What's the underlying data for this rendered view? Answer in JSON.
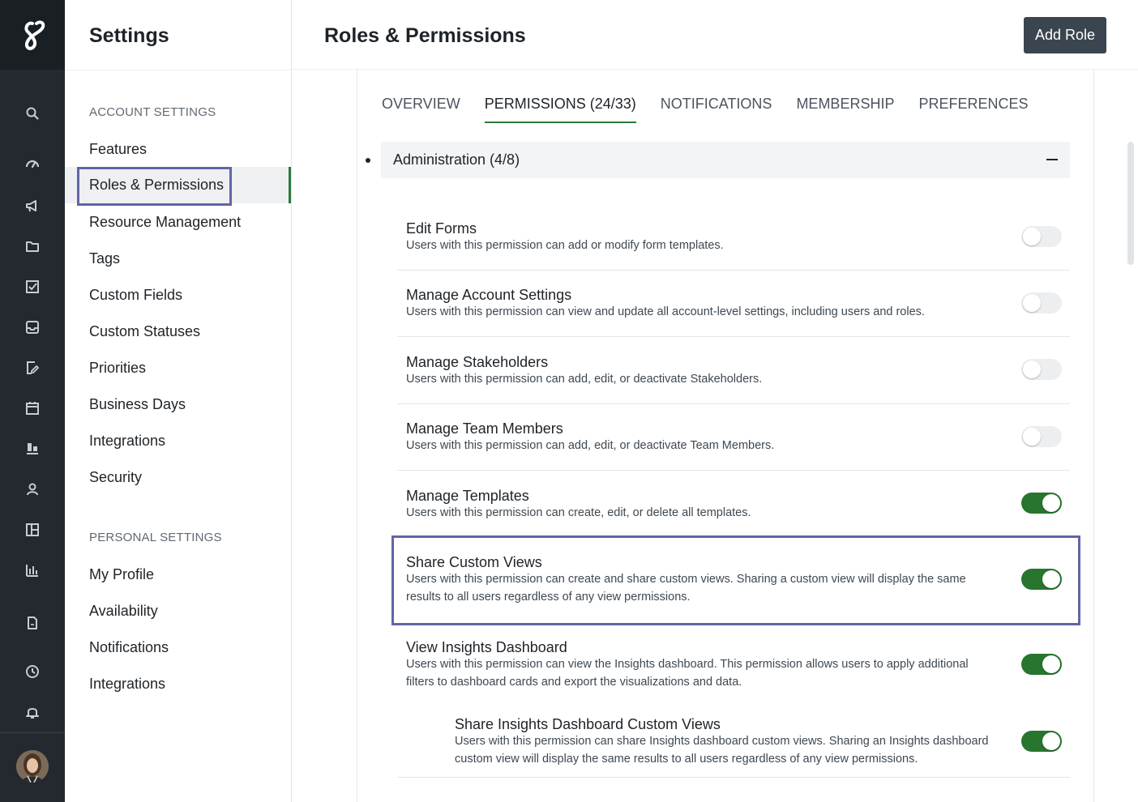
{
  "app": {
    "brand_color": "#2b7a3b",
    "highlight_color": "#6165a8"
  },
  "rail": {
    "icons": [
      "logo-icon",
      "search-icon",
      "dashboard-icon",
      "megaphone-icon",
      "folder-icon",
      "checkbox-icon",
      "inbox-icon",
      "form-edit-icon",
      "calendar-icon",
      "workload-icon",
      "person-icon",
      "layout-icon",
      "chart-icon",
      "document-icon",
      "clock-icon",
      "bell-icon"
    ]
  },
  "sidebar": {
    "title": "Settings",
    "account_label": "ACCOUNT SETTINGS",
    "account_items": [
      {
        "label": "Features"
      },
      {
        "label": "Roles & Permissions"
      },
      {
        "label": "Resource Management"
      },
      {
        "label": "Tags"
      },
      {
        "label": "Custom Fields"
      },
      {
        "label": "Custom Statuses"
      },
      {
        "label": "Priorities"
      },
      {
        "label": "Business Days"
      },
      {
        "label": "Integrations"
      },
      {
        "label": "Security"
      }
    ],
    "personal_label": "PERSONAL SETTINGS",
    "personal_items": [
      {
        "label": "My Profile"
      },
      {
        "label": "Availability"
      },
      {
        "label": "Notifications"
      },
      {
        "label": "Integrations"
      }
    ]
  },
  "header": {
    "title": "Roles & Permissions",
    "add_role": "Add Role"
  },
  "tabs": [
    {
      "label": "OVERVIEW"
    },
    {
      "label": "PERMISSIONS (24/33)"
    },
    {
      "label": "NOTIFICATIONS"
    },
    {
      "label": "MEMBERSHIP"
    },
    {
      "label": "PREFERENCES"
    }
  ],
  "group": {
    "title": "Administration (4/8)"
  },
  "permissions": [
    {
      "name": "Edit Forms",
      "desc": "Users with this permission can add or modify form templates.",
      "on": false
    },
    {
      "name": "Manage Account Settings",
      "desc": "Users with this permission can view and update all account-level settings, including users and roles.",
      "on": false
    },
    {
      "name": "Manage Stakeholders",
      "desc": "Users with this permission can add, edit, or deactivate Stakeholders.",
      "on": false
    },
    {
      "name": "Manage Team Members",
      "desc": "Users with this permission can add, edit, or deactivate Team Members.",
      "on": false
    },
    {
      "name": "Manage Templates",
      "desc": "Users with this permission can create, edit, or delete all templates.",
      "on": true
    },
    {
      "name": "Share Custom Views",
      "desc": "Users with this permission can create and share custom views. Sharing a custom view will display the same results to all users regardless of any view permissions.",
      "on": true
    },
    {
      "name": "View Insights Dashboard",
      "desc": "Users with this permission can view the Insights dashboard. This permission allows users to apply additional filters to dashboard cards and export the visualizations and data.",
      "on": true
    },
    {
      "name": "Share Insights Dashboard Custom Views",
      "desc": "Users with this permission can share Insights dashboard custom views. Sharing an Insights dashboard custom view will display the same results to all users regardless of any view permissions.",
      "on": true
    }
  ]
}
